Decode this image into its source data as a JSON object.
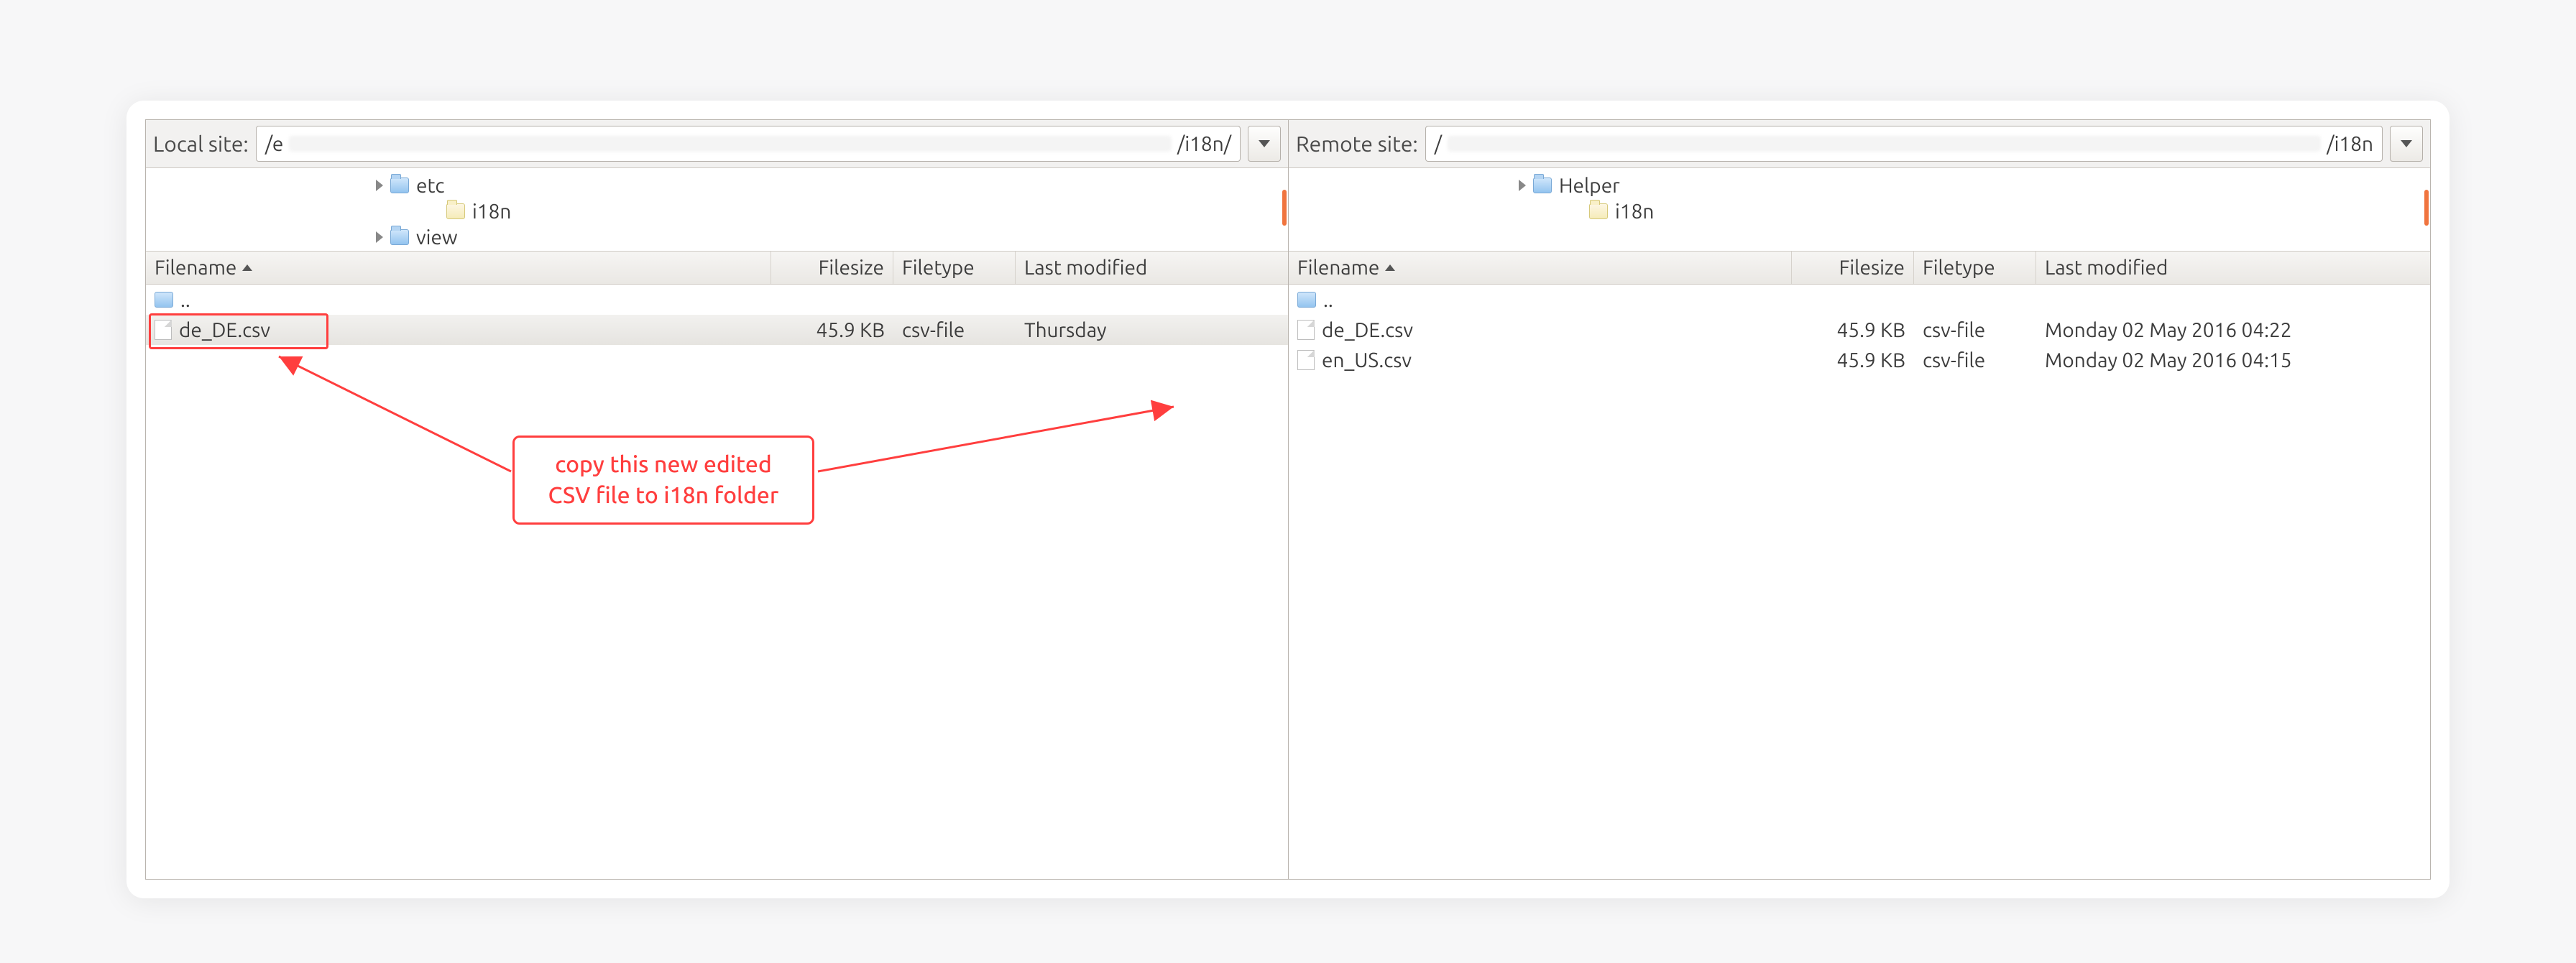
{
  "local": {
    "label": "Local site:",
    "path_prefix": "/e",
    "path_suffix": "/i18n/",
    "tree": [
      {
        "caret": true,
        "icon": "folder",
        "label": "etc"
      },
      {
        "caret": false,
        "icon": "folder-light",
        "label": "i18n",
        "indent": true
      },
      {
        "caret": true,
        "icon": "folder",
        "label": "view"
      }
    ],
    "columns": {
      "filename": "Filename",
      "filesize": "Filesize",
      "filetype": "Filetype",
      "lastmod": "Last modified"
    },
    "rows": [
      {
        "up": true,
        "name": ".."
      },
      {
        "name": "de_DE.csv",
        "size": "45.9 KB",
        "type": "csv-file",
        "mod": "Thursday",
        "selected": true
      }
    ]
  },
  "remote": {
    "label": "Remote site:",
    "path_prefix": "/",
    "path_suffix": "/i18n",
    "tree": [
      {
        "caret": true,
        "icon": "folder",
        "label": "Helper"
      },
      {
        "caret": false,
        "icon": "folder-light",
        "label": "i18n",
        "indent": true
      },
      {
        "caret": false,
        "icon": "",
        "label": ""
      }
    ],
    "columns": {
      "filename": "Filename",
      "filesize": "Filesize",
      "filetype": "Filetype",
      "lastmod": "Last modified"
    },
    "rows": [
      {
        "up": true,
        "name": ".."
      },
      {
        "name": "de_DE.csv",
        "size": "45.9 KB",
        "type": "csv-file",
        "mod": "Monday 02 May 2016 04:22"
      },
      {
        "name": "en_US.csv",
        "size": "45.9 KB",
        "type": "csv-file",
        "mod": "Monday 02 May 2016 04:15"
      }
    ]
  },
  "annotation": {
    "line1": "copy this new edited",
    "line2": "CSV file to i18n folder"
  }
}
